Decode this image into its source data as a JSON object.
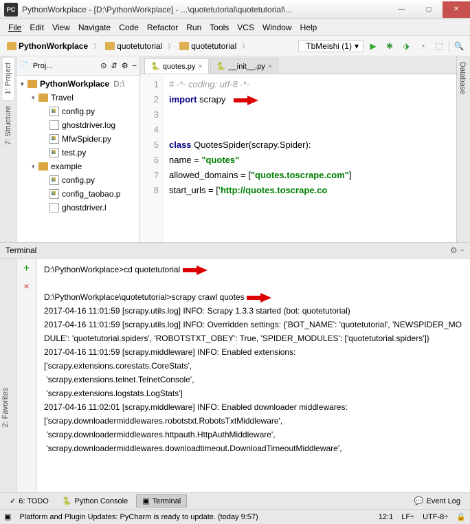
{
  "window": {
    "logo": "PC",
    "title": "PythonWorkplace - [D:\\PythonWorkplace] - ...\\quotetutorial\\quotetutorial\\..."
  },
  "menu": [
    "File",
    "Edit",
    "View",
    "Navigate",
    "Code",
    "Refactor",
    "Run",
    "Tools",
    "VCS",
    "Window",
    "Help"
  ],
  "breadcrumb": {
    "root": "PythonWorkplace",
    "p1": "quotetutorial",
    "p2": "quotetutorial"
  },
  "run_config": {
    "label": "TbMeishi (1)",
    "dropdown": "▾"
  },
  "sidetabs": {
    "project": "1: Project",
    "structure": "7: Structure",
    "favorites": "2: Favorites",
    "database": "Database"
  },
  "project_panel": {
    "title": "Proj...",
    "tree": [
      {
        "kind": "root",
        "label": "PythonWorkplace",
        "hint": "D:\\",
        "bold": true,
        "indent": 0,
        "arrow": "▾",
        "folder": true
      },
      {
        "kind": "folder",
        "label": "Travel",
        "indent": 1,
        "arrow": "▾",
        "folder": true
      },
      {
        "kind": "py",
        "label": "config.py",
        "indent": 2
      },
      {
        "kind": "file",
        "label": "ghostdriver.log",
        "indent": 2
      },
      {
        "kind": "py",
        "label": "MfwSpider.py",
        "indent": 2
      },
      {
        "kind": "py",
        "label": "test.py",
        "indent": 2
      },
      {
        "kind": "folder",
        "label": "example",
        "indent": 1,
        "arrow": "▾",
        "folder": true
      },
      {
        "kind": "py",
        "label": "config.py",
        "indent": 2
      },
      {
        "kind": "py",
        "label": "config_taobao.p",
        "indent": 2
      },
      {
        "kind": "file",
        "label": "ghostdriver.l",
        "indent": 2
      }
    ]
  },
  "editor": {
    "tabs": [
      {
        "name": "quotes.py",
        "active": true
      },
      {
        "name": "__init__.py",
        "active": false
      }
    ],
    "lines": [
      "1",
      "2",
      "3",
      "4",
      "5",
      "6",
      "7",
      "8"
    ],
    "code": {
      "l1_c": "# -*- coding: utf-8 -*-",
      "l2_k1": "import",
      "l2_n": " scrapy",
      "l5_k": "class",
      "l5_n": " QuotesSpider(scrapy.Spider):",
      "l6_n": "    name = ",
      "l6_s": "\"quotes\"",
      "l7_n": "    allowed_domains = [",
      "l7_s": "\"quotes.toscrape.com\"",
      "l7_end": "]",
      "l8_n": "    start_urls = [",
      "l8_s": "'http://quotes.toscrape.co"
    }
  },
  "terminal": {
    "title": "Terminal",
    "lines": [
      "D:\\PythonWorkplace>cd quotetutorial",
      "",
      "D:\\PythonWorkplace\\quotetutorial>scrapy crawl quotes",
      "2017-04-16 11:01:59 [scrapy.utils.log] INFO: Scrapy 1.3.3 started (bot: quotetutorial)",
      "2017-04-16 11:01:59 [scrapy.utils.log] INFO: Overridden settings: {'BOT_NAME': 'quotetutorial', 'NEWSPIDER_MODULE': 'quotetutorial.spiders', 'ROBOTSTXT_OBEY': True, 'SPIDER_MODULES': ['quotetutorial.spiders']}",
      "2017-04-16 11:01:59 [scrapy.middleware] INFO: Enabled extensions:",
      "['scrapy.extensions.corestats.CoreStats',",
      " 'scrapy.extensions.telnet.TelnetConsole',",
      " 'scrapy.extensions.logstats.LogStats']",
      "2017-04-16 11:02:01 [scrapy.middleware] INFO: Enabled downloader middlewares:",
      "['scrapy.downloadermiddlewares.robotstxt.RobotsTxtMiddleware',",
      " 'scrapy.downloadermiddlewares.httpauth.HttpAuthMiddleware',",
      " 'scrapy.downloadermiddlewares.downloadtimeout.DownloadTimeoutMiddleware',"
    ]
  },
  "toolwindows": {
    "todo": "6: TODO",
    "pyconsole": "Python Console",
    "terminal": "Terminal",
    "eventlog": "Event Log"
  },
  "status": {
    "msg": "Platform and Plugin Updates: PyCharm is ready to update. (today 9:57)",
    "pos": "12:1",
    "lf": "LF÷",
    "enc": "UTF-8÷",
    "lock": "🔒"
  }
}
